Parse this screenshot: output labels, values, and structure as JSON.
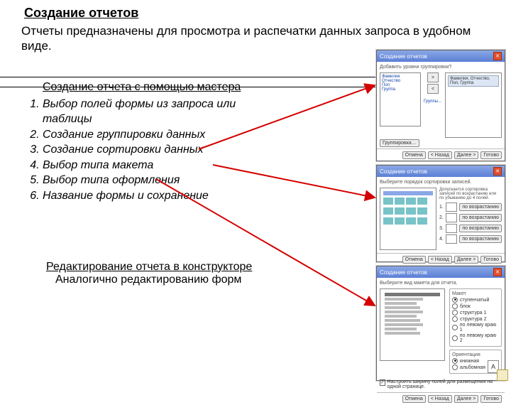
{
  "title": "Создание отчетов",
  "intro": "Отчеты предназначены для просмотра и распечатки данных запроса в удобном виде.",
  "section1_heading": "Создание отчета с помощью мастера",
  "steps": [
    "Выбор полей формы из запроса или таблицы",
    "Создание группировки данных",
    "Создание сортировки данных",
    "Выбор типа макета",
    "Выбор типа оформления",
    "Название формы и сохранение"
  ],
  "section2_heading": "Редактирование отчета в конструкторе",
  "section2_text": "Аналогично редактированию форм",
  "wizard_common": {
    "title": "Создание отчетов",
    "close": "✕",
    "buttons": {
      "cancel": "Отмена",
      "back": "< Назад",
      "next": "Далее >",
      "finish": "Готово"
    }
  },
  "wizard1": {
    "prompt": "Добавить уровни группировки?",
    "fields": [
      "Фамилия",
      "Отчество",
      "Пол",
      "Группа"
    ],
    "arrow_r": ">",
    "arrow_l": "<",
    "link": "Группы…",
    "preview_line": "Фамилия, Отчество, Пол, Группа",
    "extra_btn": "Группировка…"
  },
  "wizard2": {
    "prompt": "Выберите порядок сортировки записей.",
    "note": "Допускается сортировка записей по возрастанию или по убыванию до 4 полей.",
    "numbers": [
      "1.",
      "2.",
      "3.",
      "4."
    ],
    "order_btn": "по возрастанию"
  },
  "wizard3": {
    "prompt": "Выберите вид макета для отчета.",
    "layout_caption": "Макет",
    "layouts": [
      "ступенчатый",
      "блок",
      "структура 1",
      "структура 2",
      "по левому краю 1",
      "по левому краю 2"
    ],
    "orient_caption": "Ориентация",
    "orients": [
      "книжная",
      "альбомная"
    ],
    "orient_icon": "A",
    "check_label": "Настроить ширину полей для размещения на одной странице."
  }
}
